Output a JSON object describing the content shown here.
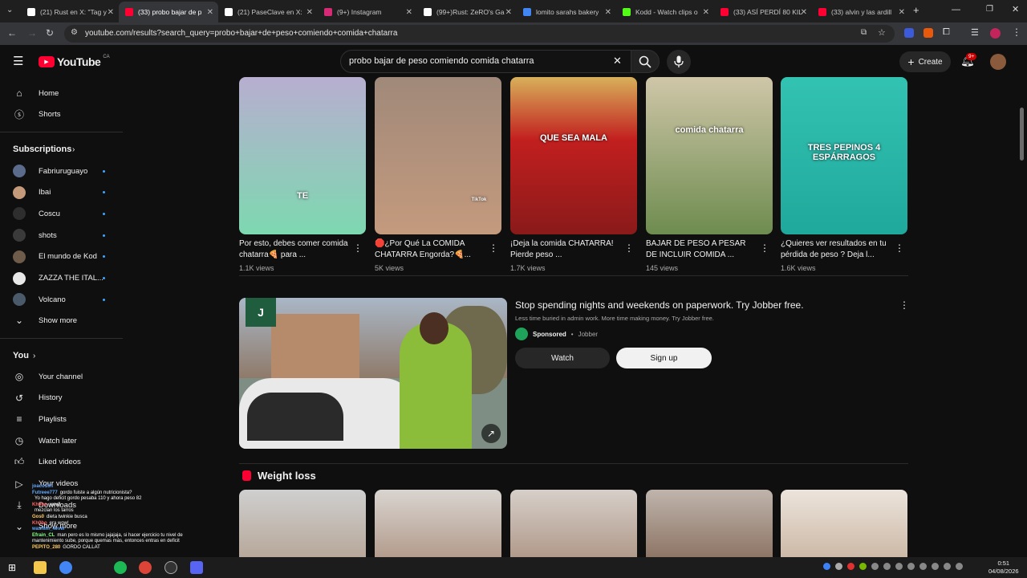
{
  "browser": {
    "tabs": [
      {
        "label": "(21) Rust en X: \"Tag y",
        "icon": "x-logo-icon",
        "color": "#ffffff"
      },
      {
        "label": "(33) probo bajar de p",
        "icon": "youtube-icon",
        "color": "#ff0033"
      },
      {
        "label": "(21) PaseClave en X:",
        "icon": "x-logo-icon",
        "color": "#ffffff"
      },
      {
        "label": "(9+) Instagram",
        "icon": "instagram-icon",
        "color": "#d62976"
      },
      {
        "label": "(99+)Rust: ZeRO's Ga",
        "icon": "tiktok-icon",
        "color": "#ffffff"
      },
      {
        "label": "lomito sarahs bakery",
        "icon": "google-icon",
        "color": "#4285f4"
      },
      {
        "label": "Kodd - Watch clips o",
        "icon": "kick-icon",
        "color": "#53fc18"
      },
      {
        "label": "(33) ASÍ PERDÍ 80 KIL",
        "icon": "youtube-icon",
        "color": "#ff0033"
      },
      {
        "label": "(33) alvin y las ardill",
        "icon": "youtube-icon",
        "color": "#ff0033"
      }
    ],
    "url": "youtube.com/results?search_query=probo+bajar+de+peso+comiendo+comida+chatarra"
  },
  "youtube": {
    "logo": "YouTube",
    "region": "CA",
    "search_value": "probo bajar de peso comiendo comida chatarra",
    "create_label": "Create",
    "notif_count": "9+"
  },
  "sidebar": {
    "home": "Home",
    "shorts": "Shorts",
    "subscriptions": "Subscriptions",
    "channels": [
      {
        "name": "Fabriuruguayo",
        "color": "#5a6b8c"
      },
      {
        "name": "Ibai",
        "color": "#c49a7a"
      },
      {
        "name": "Coscu",
        "color": "#2e2e2e"
      },
      {
        "name": "shots",
        "color": "#3a3a3a"
      },
      {
        "name": "El mundo de Kod",
        "color": "#6e5b4a"
      },
      {
        "name": "ZAZZA THE ITAL...",
        "color": "#e8e8e8"
      },
      {
        "name": "Volcano",
        "color": "#4b5a6b"
      }
    ],
    "show_more": "Show more",
    "you": "You",
    "you_items": [
      "Your channel",
      "History",
      "Playlists",
      "Watch later",
      "Liked videos",
      "Your videos",
      "Downloads",
      "Show more"
    ]
  },
  "chat": [
    {
      "user": "joaco16h",
      "msg": "",
      "color": "#66aaff"
    },
    {
      "user": "Futreee777",
      "msg": "gordo fuiste a algún nutricionista?",
      "color": "#66aaff"
    },
    {
      "user": "",
      "msg": "Yo hago deficit gordo pesaba 110 y ahora peso 82",
      "color": "#ffffff"
    },
    {
      "user": "Kh0bo",
      "msg": "wow!",
      "color": "#ff6666"
    },
    {
      "user": "",
      "msg": "mezclan los tarros",
      "color": "#ffffff"
    },
    {
      "user": "Gos0",
      "msg": "dieta twinkie busca",
      "color": "#ffcc66"
    },
    {
      "user": "Kh0bo",
      "msg": "era wow!",
      "color": "#ff6666"
    },
    {
      "user": "washim_4ever",
      "msg": "",
      "color": "#66aaff"
    },
    {
      "user": "Efrain_CL",
      "msg": "man pero es lo mismo jajajaja, si hacer ejercicio tu nivel de mantenimiento sube, porque quemas más, entonces entras en deficit",
      "color": "#88ff88"
    },
    {
      "user": "PEPITO_280",
      "msg": "GORDO CALLAT",
      "color": "#ffcc66"
    }
  ],
  "videos": [
    {
      "title": "Por esto, debes comer comida chatarra🍕 para ...",
      "views": "1.1K views",
      "overlay": "TE"
    },
    {
      "title": "🛑¿Por Qué La COMIDA CHATARRA Engorda?🍕...",
      "views": "5K views",
      "overlay": "TikTok"
    },
    {
      "title": "¡Deja la comida CHATARRA! Pierde peso ...",
      "views": "1.7K views",
      "overlay": "QUE SEA MALA"
    },
    {
      "title": "BAJAR DE PESO A PESAR DE INCLUIR COMIDA ...",
      "views": "145 views",
      "overlay": "comida chatarra"
    },
    {
      "title": "¿Quieres ver resultados  en tu pérdida de peso ? Deja l...",
      "views": "1.6K views",
      "overlay": "TRES PEPINOS 4 ESPÁRRAGOS"
    }
  ],
  "ad": {
    "title": "Stop spending nights and weekends on paperwork. Try Jobber free.",
    "desc": "Less time buried in admin work. More time making money. Try Jobber free.",
    "sponsored": "Sponsored",
    "advertiser": "Jobber",
    "watch": "Watch",
    "signup": "Sign up"
  },
  "shelf": {
    "title": "Weight loss"
  },
  "taskbar": {
    "time": "0:51",
    "date": "04/08/2026"
  }
}
